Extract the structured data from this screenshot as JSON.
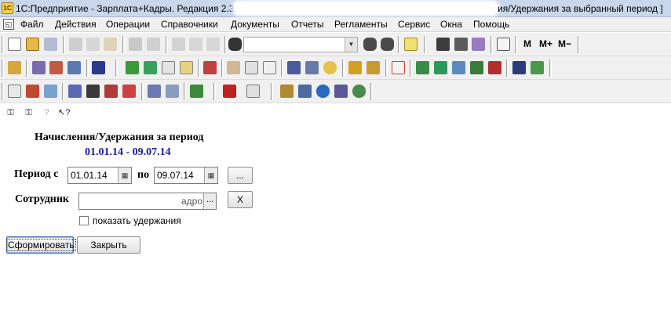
{
  "window": {
    "title_left": "1С:Предприятие - Зарплата+Кадры. Редакция 2.3:",
    "title_right": "ия/Удержания за выбранный период ]"
  },
  "menu": {
    "items": [
      "Файл",
      "Действия",
      "Операции",
      "Справочники",
      "Документы",
      "Отчеты",
      "Регламенты",
      "Сервис",
      "Окна",
      "Помощь"
    ]
  },
  "toolbar": {
    "mem_m": "M",
    "mem_mplus": "M+",
    "mem_mminus": "M−",
    "search_combo_value": ""
  },
  "form": {
    "title": "Начисления/Удержания за период",
    "subtitle": "01.01.14 - 09.07.14",
    "period_label": "Период с",
    "period_from": "01.01.14",
    "period_to_label": "по",
    "period_to": "09.07.14",
    "period_select_btn": "...",
    "employee_label": "Сотрудник",
    "employee_value_tail": "адро",
    "employee_select_btn": "...",
    "employee_clear_btn": "X",
    "show_deductions_label": "показать удержания",
    "show_deductions_checked": false,
    "generate_btn": "Сформировать",
    "close_btn": "Закрыть"
  },
  "colors": {
    "subtitle": "#1a1aa0",
    "titlebar": "#c9d7ea",
    "toolbar_bg": "#f0f0f0"
  }
}
